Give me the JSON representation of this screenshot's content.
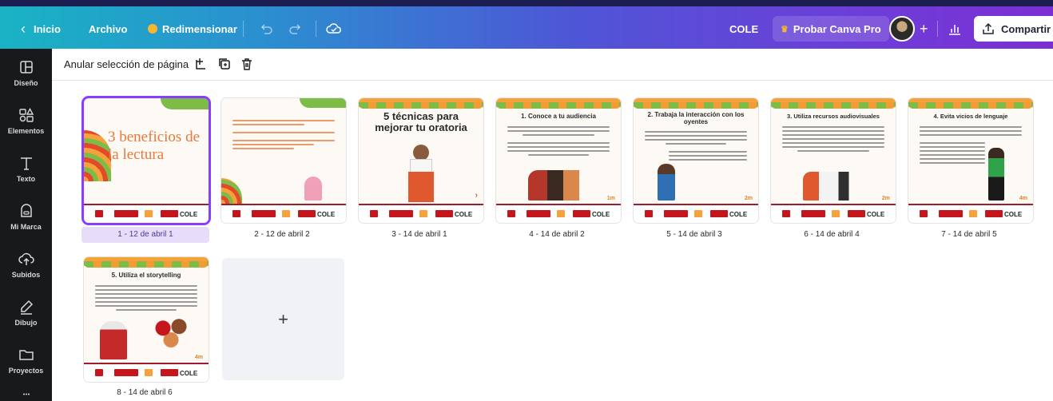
{
  "topbar": {
    "back_label": "Inicio",
    "file_label": "Archivo",
    "resize_label": "Redimensionar",
    "doc_title": "COLE",
    "pro_label": "Probar Canva Pro",
    "share_label": "Compartir",
    "add_label": "+"
  },
  "sidebar": {
    "items": [
      {
        "label": "Diseño",
        "icon": "layout-icon"
      },
      {
        "label": "Elementos",
        "icon": "elements-icon"
      },
      {
        "label": "Texto",
        "icon": "text-icon"
      },
      {
        "label": "Mi Marca",
        "icon": "brand-icon"
      },
      {
        "label": "Subidos",
        "icon": "upload-icon"
      },
      {
        "label": "Dibujo",
        "icon": "draw-icon"
      },
      {
        "label": "Proyectos",
        "icon": "folder-icon"
      }
    ]
  },
  "toolbar": {
    "deselect_label": "Anular selección de página"
  },
  "pages": [
    {
      "caption": "1 - 12 de abril 1",
      "title": "3 beneficios de la lectura"
    },
    {
      "caption": "2 - 12 de abril 2",
      "title": ""
    },
    {
      "caption": "3 - 14 de abril 1",
      "title": "5 técnicas para mejorar tu oratoria"
    },
    {
      "caption": "4 - 14 de abril  2",
      "title": "1. Conoce a tu audiencia"
    },
    {
      "caption": "5 - 14 de abril 3",
      "title": "2. Trabaja la interacción con los oyentes"
    },
    {
      "caption": "6 - 14 de abril 4",
      "title": "3. Utiliza recursos audiovisuales"
    },
    {
      "caption": "7 - 14 de abril 5",
      "title": "4. Evita vicios de lenguaje"
    },
    {
      "caption": "8 - 14 de abril 6",
      "title": "5. Utiliza el storytelling"
    }
  ],
  "footer_brand": "COLE",
  "add_page_label": "+",
  "colors": {
    "accent": "#8b3dff",
    "topbar_start": "#19b3c4",
    "topbar_end": "#7b2fd3",
    "sidebar": "#18191b"
  }
}
